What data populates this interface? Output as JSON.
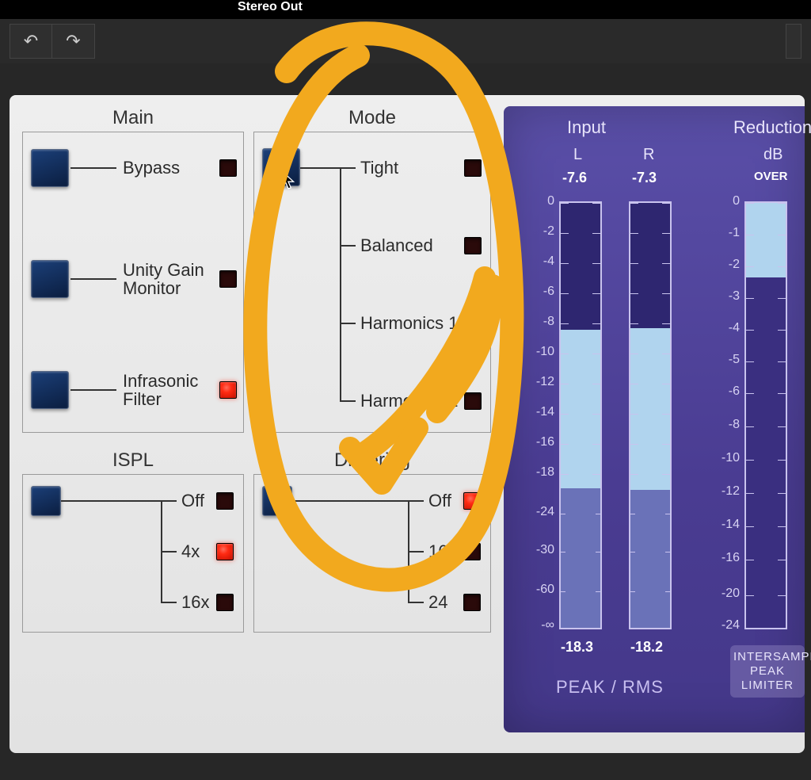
{
  "window": {
    "title": "Stereo Out"
  },
  "toolbar": {
    "undo_glyph": "↶",
    "redo_glyph": "↷"
  },
  "main": {
    "title": "Main",
    "items": [
      {
        "label": "Bypass",
        "lit": false
      },
      {
        "label": "Unity Gain\nMonitor",
        "lit": false
      },
      {
        "label": "Infrasonic\nFilter",
        "lit": true
      }
    ]
  },
  "mode": {
    "title": "Mode",
    "items": [
      {
        "label": "Tight",
        "lit": false
      },
      {
        "label": "Balanced",
        "lit": false
      },
      {
        "label": "Harmonics 1",
        "lit": true
      },
      {
        "label": "Harmonics 2",
        "lit": false
      }
    ]
  },
  "ispl": {
    "title": "ISPL",
    "items": [
      {
        "label": "Off",
        "lit": false
      },
      {
        "label": "4x",
        "lit": true
      },
      {
        "label": "16x",
        "lit": false
      }
    ]
  },
  "dithering": {
    "title": "Dithering",
    "items": [
      {
        "label": "Off",
        "lit": true
      },
      {
        "label": "16",
        "lit": false
      },
      {
        "label": "24",
        "lit": false
      }
    ]
  },
  "meters": {
    "input_title": "Input",
    "reduction_title": "Reduction",
    "L_label": "L",
    "R_label": "R",
    "dB_label": "dB",
    "over_label": "OVER",
    "L_peak": "-7.6",
    "R_peak": "-7.3",
    "L_rms": "-18.3",
    "R_rms": "-18.2",
    "input_scale": [
      "0",
      "-2",
      "-4",
      "-6",
      "-8",
      "-10",
      "-12",
      "-14",
      "-16",
      "-18",
      "-24",
      "-30",
      "-60",
      "-∞"
    ],
    "reduction_scale": [
      "0",
      "-1",
      "-2",
      "-3",
      "-4",
      "-5",
      "-6",
      "-8",
      "-10",
      "-12",
      "-14",
      "-16",
      "-20",
      "-24"
    ],
    "footer": "PEAK / RMS",
    "ispl_badge": "INTERSAMPLE\nPEAK\nLIMITER"
  }
}
